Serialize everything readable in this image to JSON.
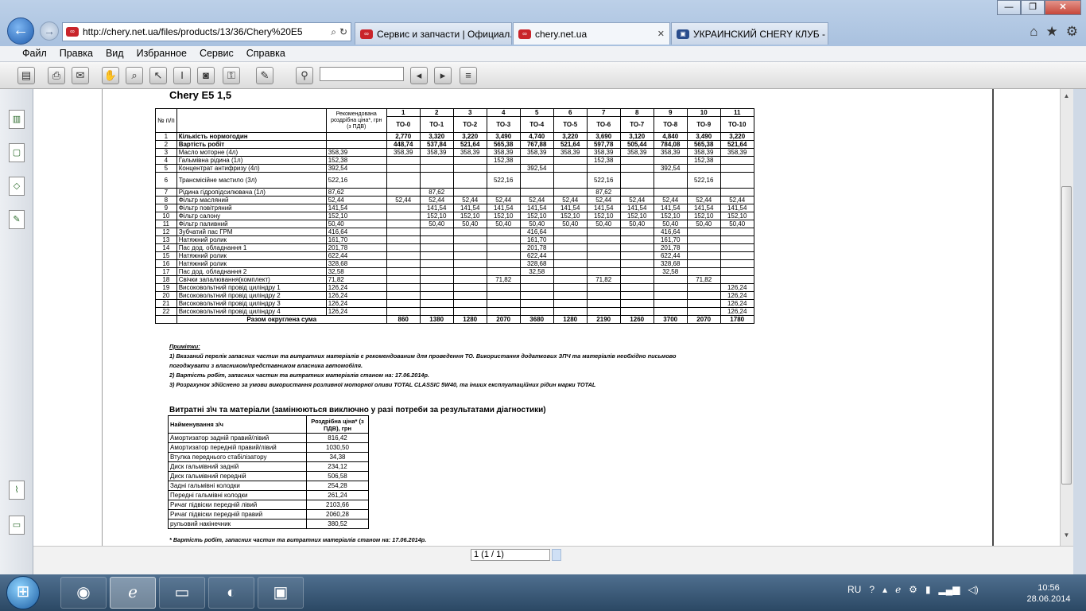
{
  "browser": {
    "address": "http://chery.net.ua/files/products/13/36/Chery%20E5",
    "tabs": [
      "Сервис и запчасти | Официал...",
      "chery.net.ua",
      "УКРАИНСКИЙ CHERY КЛУБ - ..."
    ],
    "menu": [
      "Файл",
      "Правка",
      "Вид",
      "Избранное",
      "Сервис",
      "Справка"
    ]
  },
  "doc": {
    "title": "Chery E5 1,5",
    "header": {
      "num": "№ п/п",
      "price": "Рекомендована роздрібна ціна*, грн (з ПДВ)",
      "cols": [
        "1",
        "2",
        "3",
        "4",
        "5",
        "6",
        "7",
        "8",
        "9",
        "10",
        "11"
      ],
      "to": [
        "ТО-0",
        "ТО-1",
        "ТО-2",
        "ТО-3",
        "ТО-4",
        "ТО-5",
        "ТО-6",
        "ТО-7",
        "ТО-8",
        "ТО-9",
        "ТО-10"
      ]
    },
    "rows": [
      {
        "n": "1",
        "name": "Кількість нормогодин",
        "price": "",
        "v": [
          "2,770",
          "3,320",
          "3,220",
          "3,490",
          "4,740",
          "3,220",
          "3,690",
          "3,120",
          "4,840",
          "3,490",
          "3,220"
        ],
        "bold": true
      },
      {
        "n": "2",
        "name": "Вартість робіт",
        "price": "",
        "v": [
          "448,74",
          "537,84",
          "521,64",
          "565,38",
          "767,88",
          "521,64",
          "597,78",
          "505,44",
          "784,08",
          "565,38",
          "521,64"
        ],
        "bold": true
      },
      {
        "n": "3",
        "name": "Масло моторне (4л)",
        "price": "358,39",
        "v": [
          "358,39",
          "358,39",
          "358,39",
          "358,39",
          "358,39",
          "358,39",
          "358,39",
          "358,39",
          "358,39",
          "358,39",
          "358,39"
        ]
      },
      {
        "n": "4",
        "name": "Гальмівна рідина (1л)",
        "price": "152,38",
        "v": [
          "",
          "",
          "",
          "152,38",
          "",
          "",
          "152,38",
          "",
          "",
          "152,38",
          ""
        ]
      },
      {
        "n": "5",
        "name": "Концентрат антифризу (4л)",
        "price": "392,54",
        "v": [
          "",
          "",
          "",
          "",
          "392,54",
          "",
          "",
          "",
          "392,54",
          "",
          ""
        ]
      },
      {
        "n": "6",
        "name": "Трансмісійне мастило (3л)",
        "price": "522,16",
        "v": [
          "",
          "",
          "",
          "522,16",
          "",
          "",
          "522,16",
          "",
          "",
          "522,16",
          ""
        ],
        "tall": true
      },
      {
        "n": "7",
        "name": "Рідина гідропідсилювача (1л)",
        "price": "87,62",
        "v": [
          "",
          "87,62",
          "",
          "",
          "",
          "",
          "87,62",
          "",
          "",
          "",
          ""
        ]
      },
      {
        "n": "8",
        "name": "Фільтр масляний",
        "price": "52,44",
        "v": [
          "52,44",
          "52,44",
          "52,44",
          "52,44",
          "52,44",
          "52,44",
          "52,44",
          "52,44",
          "52,44",
          "52,44",
          "52,44"
        ]
      },
      {
        "n": "9",
        "name": "Фільтр повітряний",
        "price": "141,54",
        "v": [
          "",
          "141,54",
          "141,54",
          "141,54",
          "141,54",
          "141,54",
          "141,54",
          "141,54",
          "141,54",
          "141,54",
          "141,54"
        ]
      },
      {
        "n": "10",
        "name": "Фільтр салону",
        "price": "152,10",
        "v": [
          "",
          "152,10",
          "152,10",
          "152,10",
          "152,10",
          "152,10",
          "152,10",
          "152,10",
          "152,10",
          "152,10",
          "152,10"
        ]
      },
      {
        "n": "11",
        "name": "Фільтр паливний",
        "price": "50,40",
        "v": [
          "",
          "50,40",
          "50,40",
          "50,40",
          "50,40",
          "50,40",
          "50,40",
          "50,40",
          "50,40",
          "50,40",
          "50,40"
        ]
      },
      {
        "n": "12",
        "name": "Зубчатий пас ГРМ",
        "price": "416,64",
        "v": [
          "",
          "",
          "",
          "",
          "416,64",
          "",
          "",
          "",
          "416,64",
          "",
          ""
        ]
      },
      {
        "n": "13",
        "name": "Натяжний ролик",
        "price": "161,70",
        "v": [
          "",
          "",
          "",
          "",
          "161,70",
          "",
          "",
          "",
          "161,70",
          "",
          ""
        ]
      },
      {
        "n": "14",
        "name": "Пас дод. обладнання 1",
        "price": "201,78",
        "v": [
          "",
          "",
          "",
          "",
          "201,78",
          "",
          "",
          "",
          "201,78",
          "",
          ""
        ]
      },
      {
        "n": "15",
        "name": "Натяжний ролик",
        "price": "622,44",
        "v": [
          "",
          "",
          "",
          "",
          "622,44",
          "",
          "",
          "",
          "622,44",
          "",
          ""
        ]
      },
      {
        "n": "16",
        "name": "Натяжний ролик",
        "price": "328,68",
        "v": [
          "",
          "",
          "",
          "",
          "328,68",
          "",
          "",
          "",
          "328,68",
          "",
          ""
        ]
      },
      {
        "n": "17",
        "name": "Пас дод. обладнання 2",
        "price": "32,58",
        "v": [
          "",
          "",
          "",
          "",
          "32,58",
          "",
          "",
          "",
          "32,58",
          "",
          ""
        ]
      },
      {
        "n": "18",
        "name": "Свічки запалювання(комплект)",
        "price": "71,82",
        "v": [
          "",
          "",
          "",
          "71,82",
          "",
          "",
          "71,82",
          "",
          "",
          "71,82",
          ""
        ]
      },
      {
        "n": "19",
        "name": "Високовольтний провід циліндру 1",
        "price": "126,24",
        "v": [
          "",
          "",
          "",
          "",
          "",
          "",
          "",
          "",
          "",
          "",
          "126,24"
        ]
      },
      {
        "n": "20",
        "name": "Високовольтний провід циліндру 2",
        "price": "126,24",
        "v": [
          "",
          "",
          "",
          "",
          "",
          "",
          "",
          "",
          "",
          "",
          "126,24"
        ]
      },
      {
        "n": "21",
        "name": "Високовольтний провід циліндру 3",
        "price": "126,24",
        "v": [
          "",
          "",
          "",
          "",
          "",
          "",
          "",
          "",
          "",
          "",
          "126,24"
        ]
      },
      {
        "n": "22",
        "name": "Високовольтний провід циліндру 4",
        "price": "126,24",
        "v": [
          "",
          "",
          "",
          "",
          "",
          "",
          "",
          "",
          "",
          "",
          "126,24"
        ]
      }
    ],
    "total": {
      "label": "Разом округлена сума",
      "v": [
        "860",
        "1380",
        "1280",
        "2070",
        "3680",
        "1280",
        "2190",
        "1260",
        "3700",
        "2070",
        "1780"
      ]
    },
    "notes": [
      "Примітки:",
      "1) Вказаний перелік запасних частин та витратних матеріалів є рекомендованим для проведення ТО. Використання додаткових ЗПЧ та матеріалів необхідно письмово",
      "погоджувати з власником/представником власника автомобіля.",
      "2) Вартість робіт, запасних частин та витратних матеріалів станом на: 17.06.2014р.",
      "3) Розрахунок здійснено за умови використання розливної моторної оливи TOTAL CLASSIC 5W40, та інших експлуатаційних рідин марки TOTAL"
    ],
    "parts_title": "Витратні з\\ч та матеріали (замінюються виключно у разі потреби за результатами діагностики)",
    "parts_header": [
      "Найменування з/ч",
      "Роздрібна ціна* (з ПДВ), грн"
    ],
    "parts": [
      [
        "Амортизатор задній правий/лівий",
        "816,42"
      ],
      [
        "Амортизатор передній правий/лівий",
        "1030,50"
      ],
      [
        "Втулка переднього стабілізатору",
        "34,38"
      ],
      [
        "Диск гальмівний задній",
        "234,12"
      ],
      [
        "Диск гальмівний передній",
        "506,58"
      ],
      [
        "Задні гальмівні колодки",
        "254,28"
      ],
      [
        "Передні гальмівні колодки",
        "261,24"
      ],
      [
        "Ричаг підвіски передній лівий",
        "2103,66"
      ],
      [
        "Ричаг підвіски передній правий",
        "2060,28"
      ],
      [
        "рульовий накінечник",
        "380,52"
      ]
    ],
    "footnote": "* Вартість робіт, запасних частин та витратних матеріалів станом на: 17.06.2014р."
  },
  "viewer": {
    "page_indicator": "1 (1 / 1)"
  },
  "taskbar": {
    "lang": "RU",
    "time": "10:56",
    "date": "28.06.2014"
  }
}
